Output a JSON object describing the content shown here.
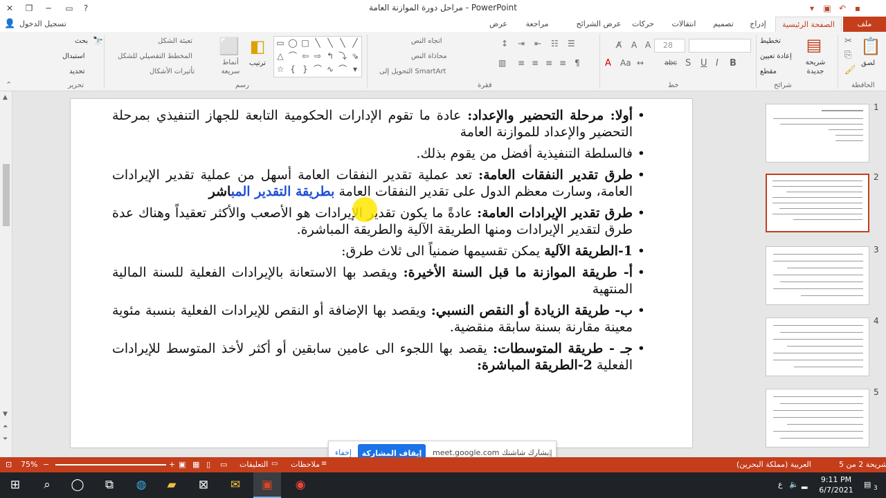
{
  "window": {
    "title": "مراحل دورة الموازنة العامة - PowerPoint",
    "signin": "تسجيل الدخول"
  },
  "tabs": [
    {
      "label": "ملف"
    },
    {
      "label": "الصفحة الرئيسية"
    },
    {
      "label": "إدراج"
    },
    {
      "label": "تصميم"
    },
    {
      "label": "انتقالات"
    },
    {
      "label": "حركات"
    },
    {
      "label": "عرض الشرائح"
    },
    {
      "label": "مراجعة"
    },
    {
      "label": "عرض"
    }
  ],
  "ribbon": {
    "clipboard": {
      "paste": "لصق",
      "group": "الحافظة"
    },
    "slides": {
      "new_slide": "شريحة جديدة",
      "layout": "تخطيط",
      "reset": "إعادة تعيين",
      "section": "مقطع",
      "group": "شرائح"
    },
    "font": {
      "size": "28",
      "group": "خط",
      "bold": "B",
      "italic": "I",
      "underline": "U",
      "strike": "S",
      "shadow": "abc"
    },
    "paragraph": {
      "text_direction": "اتجاه النص",
      "align_text": "محاذاة النص",
      "smartart": "التحويل إلى SmartArt",
      "group": "فقرة"
    },
    "drawing": {
      "arrange": "ترتيب",
      "styles": "أنماط سريعة",
      "fill": "تعبئة الشكل",
      "outline": "المخطط التفصيلي للشكل",
      "effects": "تأثيرات الأشكال",
      "group": "رسم"
    },
    "editing": {
      "find": "بحث",
      "replace": "استبدال",
      "select": "تحديد",
      "group": "تحرير"
    }
  },
  "slide": {
    "items": [
      {
        "bold": "أولا: مرحلة التحضير والإعداد:",
        "text": " عادة ما تقوم الإدارات الحكومية التابعة للجهاز التنفيذي بمرحلة التحضير والإعداد للموازنة العامة"
      },
      {
        "bold": "",
        "text": "فالسلطة التنفيذية أفضل من يقوم بذلك."
      },
      {
        "bold": "طرق تقدير النفقات العامة:",
        "text": " تعد عملية تقدير النفقات العامة أسهل من عملية تقدير الإيرادات العامة، وسارت معظم الدول على تقدير النفقات العامة ",
        "hl": "بطريقة التقدير المب",
        "tail": "اشر"
      },
      {
        "bold": "طرق تقدير الإيرادات العامة:",
        "text": " عادةً ما يكون تقدير الإيرادات هو الأصعب والأكثر تعقيداً وهناك عدة طرق لتقدير الإيرادات ومنها الطريقة الآلية والطريقة المباشرة."
      },
      {
        "bold": "1-الطريقة الآلية",
        "text": " يمكن تقسيمها ضمنياً الى ثلاث طرق:"
      },
      {
        "bold": "أ- طريقة الموازنة ما قبل السنة الأخيرة:",
        "text": " ويقصد بها الاستعانة بالإيرادات الفعلية للسنة المالية المنتهية"
      },
      {
        "bold": "ب- طريقة الزيادة أو النقص النسبي:",
        "text": " ويقصد بها الإضافة أو النقص للإيرادات الفعلية بنسبة مئوية معينة مقارنة بسنة سابقة منقضية."
      },
      {
        "bold": "جـ - طريقة المتوسطات:",
        "text": " يقصد بها اللجوء الى عامين سابقين أو أكثر لأخذ المتوسط للإيرادات الفعلية ",
        "bold2": "2-الطريقة المباشرة:"
      }
    ]
  },
  "thumbnails": [
    {
      "num": "1"
    },
    {
      "num": "2"
    },
    {
      "num": "3"
    },
    {
      "num": "4"
    },
    {
      "num": "5"
    }
  ],
  "sharebar": {
    "message": "meet.google.com يشارك شاشتك.",
    "stop": "إيقاف المشاركة",
    "hide": "إخفاء"
  },
  "status": {
    "slide_count": "شريحة 2 من 5",
    "language": "العربية (مملكة البحرين)",
    "notes": "ملاحظات",
    "comments": "التعليقات",
    "zoom": "75%"
  },
  "taskbar": {
    "time": "9:11 PM",
    "date": "6/7/2021",
    "lang": "ع",
    "notification_count": "3"
  },
  "colors": {
    "accent": "#c43e1c",
    "share_blue": "#1a73e8"
  }
}
